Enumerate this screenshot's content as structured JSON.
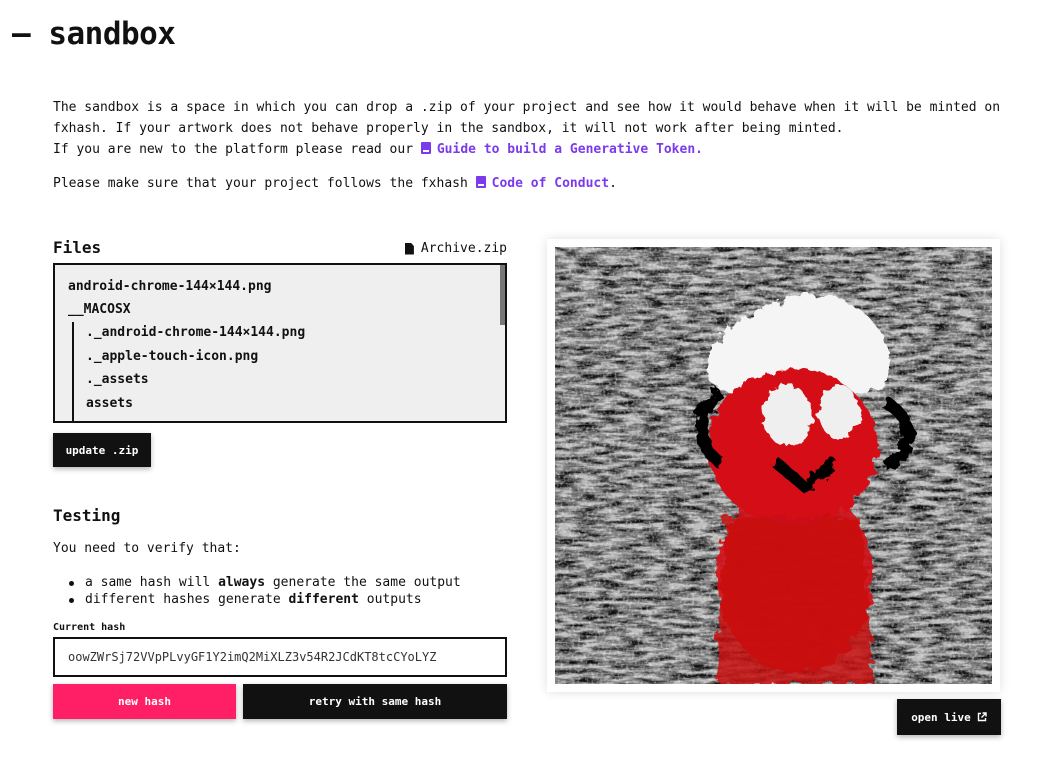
{
  "header": {
    "title": "— sandbox"
  },
  "intro": {
    "line1": "The sandbox is a space in which you can drop a .zip of your project and see how it would behave when it will be minted on fxhash. If your artwork does not behave properly in the sandbox, it will not work after being minted.",
    "line2_prefix": "If you are new to the platform please read our",
    "guide_link": "Guide to build a Generative Token.",
    "line3_prefix": "Please make sure that your project follows the fxhash",
    "conduct_link": "Code of Conduct",
    "line3_suffix": "."
  },
  "files": {
    "title": "Files",
    "archive_name": "Archive.zip",
    "tree": [
      {
        "label": "android-chrome-144×144.png",
        "nested": false
      },
      {
        "label": "__MACOSX",
        "nested": false
      },
      {
        "label": "._android-chrome-144×144.png",
        "nested": true
      },
      {
        "label": "._apple-touch-icon.png",
        "nested": true
      },
      {
        "label": "._assets",
        "nested": true
      },
      {
        "label": "assets",
        "nested": true
      }
    ],
    "update_button": "update .zip"
  },
  "testing": {
    "title": "Testing",
    "verify_text": "You need to verify that:",
    "item1_pre": "a same hash will",
    "item1_bold": "always",
    "item1_post": "generate the same output",
    "item2_pre": "different hashes generate",
    "item2_bold": "different",
    "item2_post": "outputs",
    "hash_label": "Current hash",
    "hash_value": "oowZWrSj72VVpPLvyGF1Y2imQ2MiXLZ3v54R2JCdKT8tcCYoLYZ",
    "new_hash_button": "new hash",
    "retry_button": "retry with same hash"
  },
  "preview": {
    "open_live_button": "open live"
  },
  "colors": {
    "accent": "#ff1f66",
    "link": "#7c3aed",
    "dark": "#111111"
  },
  "icons": {
    "guide_link": "book-icon",
    "conduct_link": "book-icon",
    "archive": "file-icon",
    "open_live": "external-link-icon"
  }
}
